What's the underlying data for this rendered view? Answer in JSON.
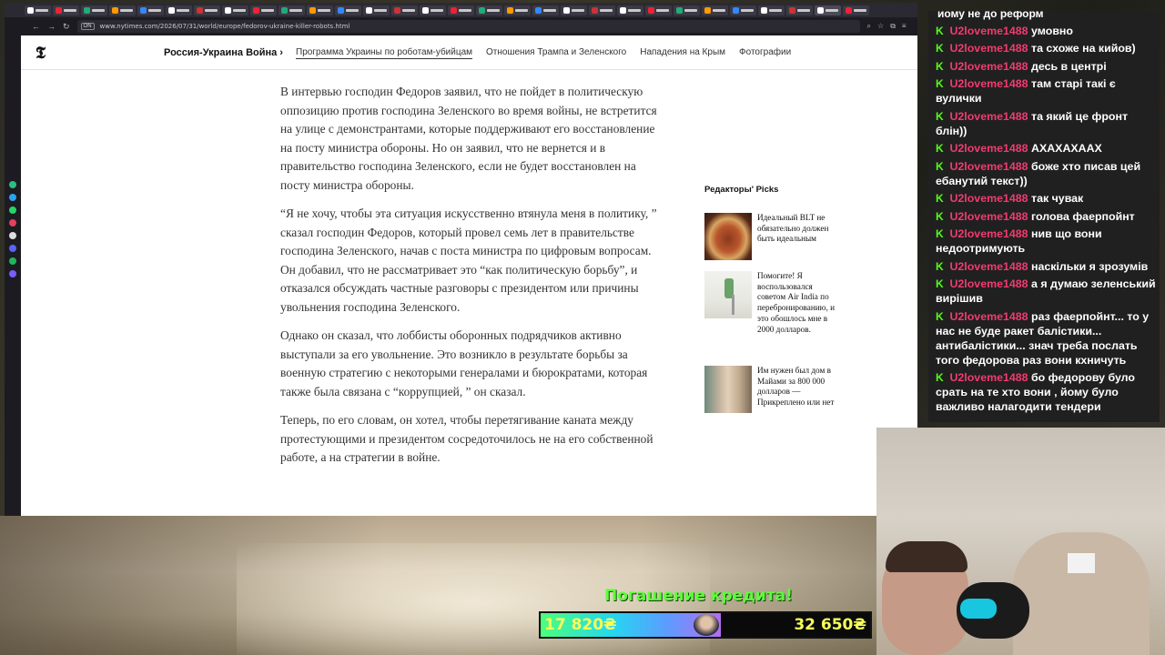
{
  "browser": {
    "url": "www.nytimes.com/2026/07/31/world/europe/fedorov-ukraine-killer-robots.html",
    "badge": "ON"
  },
  "nyt": {
    "logo": "𝕿",
    "section": "Россия-Украина Война ›",
    "subnav": [
      "Программа Украины по роботам-убийцам",
      "Отношения Трампа и Зеленского",
      "Нападения на Крым",
      "Фотографии"
    ]
  },
  "article": {
    "paragraphs": [
      "В интервью господин Федоров заявил, что не пойдет в политическую оппозицию против господина Зеленского во время войны, не встретится на улице с демонстрантами, которые поддерживают его восстановление на посту министра обороны. Но он заявил, что не вернется и в правительство господина Зеленского, если не будет восстановлен на посту министра обороны.",
      "“Я не хочу, чтобы эта ситуация искусственно втянула меня в политику, ” сказал господин Федоров, который провел семь лет в правительстве господина Зеленского, начав с поста министра по цифровым вопросам. Он добавил, что не рассматривает это “как политическую борьбу”, и отказался обсуждать частные разговоры с президентом или причины увольнения господина Зеленского.",
      "Однако он сказал, что лоббисты оборонных подрядчиков активно выступали за его увольнение. Это возникло в результате борьбы за военную стратегию с некоторыми генералами и бюрократами, которая также была связана с “коррупцией, ” он сказал.",
      "Теперь, по его словам, он хотел, чтобы перетягивание каната между протестующими и президентом сосредоточилось не на его собственной работе, а на стратегии в войне."
    ]
  },
  "picks": {
    "title": "Редакторы' Picks",
    "items": [
      {
        "text": "Идеальный BLT не обязательно должен быть идеальным"
      },
      {
        "text": "Помогите! Я воспользовался советом Air India по перебронированию, и это обошлось мне в 2000 долларов."
      },
      {
        "text": "Им нужен был дом в Майами за 800 000 долларов — Прикреплено или нет"
      }
    ]
  },
  "chat": {
    "cut_line": "йому не до реформ",
    "messages": [
      {
        "user": "U2loveme1488",
        "text": "умовно"
      },
      {
        "user": "U2loveme1488",
        "text": "та схоже на кийов)"
      },
      {
        "user": "U2loveme1488",
        "text": "десь в центрі"
      },
      {
        "user": "U2loveme1488",
        "text": "там старі такі є вулички"
      },
      {
        "user": "U2loveme1488",
        "text": "та який це фронт блін))"
      },
      {
        "user": "U2loveme1488",
        "text": "АХАХАХААХ"
      },
      {
        "user": "U2loveme1488",
        "text": "боже хто писав цей ебанутий текст))"
      },
      {
        "user": "U2loveme1488",
        "text": "так чувак"
      },
      {
        "user": "U2loveme1488",
        "text": "голова фаерпойнт"
      },
      {
        "user": "U2loveme1488",
        "text": "нив що вони недоотримують"
      },
      {
        "user": "U2loveme1488",
        "text": "наскільки я зрозумів"
      },
      {
        "user": "U2loveme1488",
        "text": "а я думаю зеленський вирішив"
      },
      {
        "user": "U2loveme1488",
        "text": "раз фаерпойнт... то у нас не буде ракет балістики... антибалістики... знач треба послать того федорова раз вони кхничуть"
      },
      {
        "user": "U2loveme1488",
        "text": "бо федорову було срать на те хто вони , йому було важливо налагодити тендери"
      }
    ]
  },
  "goal": {
    "title": "Погашение кредита!",
    "current": "17 820₴",
    "total": "32 650₴",
    "progress_fraction": 0.546
  },
  "colors": {
    "chat_user": "#f13b6f",
    "kick_green": "#53fc18",
    "goal_title": "#5dfd3a",
    "goal_amount": "#f7ff5a"
  }
}
